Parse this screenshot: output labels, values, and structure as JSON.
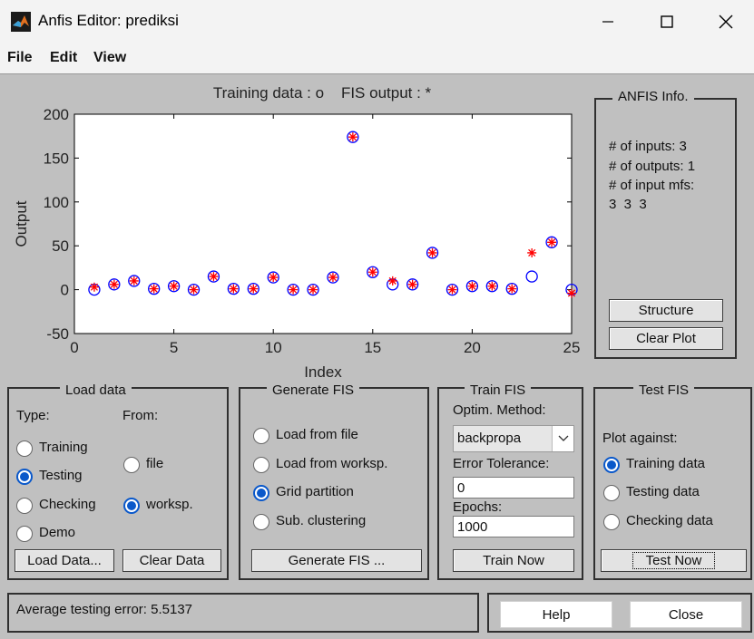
{
  "window": {
    "title": "Anfis Editor: prediksi",
    "app_icon": "matlab-icon",
    "controls": [
      "minimize-icon",
      "maximize-icon",
      "close-icon"
    ]
  },
  "menu": [
    "File",
    "Edit",
    "View"
  ],
  "plot": {
    "title": "Training data : o    FIS output : *"
  },
  "chart_data": {
    "type": "scatter",
    "xlabel": "Index",
    "ylabel": "Output",
    "xlim": [
      0,
      25
    ],
    "ylim": [
      -50,
      200
    ],
    "xticks": [
      0,
      5,
      10,
      15,
      20,
      25
    ],
    "yticks": [
      -50,
      0,
      50,
      100,
      150,
      200
    ],
    "grid": false,
    "series": [
      {
        "marker": "o",
        "color": "#0000ff",
        "x": [
          1,
          2,
          3,
          4,
          5,
          6,
          7,
          8,
          9,
          10,
          11,
          12,
          13,
          14,
          15,
          16,
          17,
          18,
          19,
          20,
          21,
          22,
          23,
          24,
          25
        ],
        "y": [
          0,
          6,
          10,
          1,
          4,
          0,
          15,
          1,
          1,
          14,
          0,
          0,
          14,
          174,
          20,
          6,
          6,
          42,
          0,
          4,
          4,
          1,
          15,
          54,
          0
        ]
      },
      {
        "marker": "*",
        "color": "#ff0000",
        "x": [
          1,
          2,
          3,
          4,
          5,
          6,
          7,
          8,
          9,
          10,
          11,
          12,
          13,
          14,
          15,
          16,
          17,
          18,
          19,
          20,
          21,
          22,
          23,
          24,
          25
        ],
        "y": [
          3,
          6,
          10,
          1,
          4,
          0,
          15,
          1,
          1,
          14,
          0,
          0,
          14,
          174,
          20,
          10,
          6,
          42,
          0,
          4,
          4,
          1,
          42,
          54,
          -4
        ]
      }
    ]
  },
  "anfis_info": {
    "legend": "ANFIS Info.",
    "lines": [
      "# of inputs: 3",
      "# of outputs: 1",
      "# of input mfs:",
      "3  3  3"
    ],
    "structure_button": "Structure",
    "clear_plot_button": "Clear Plot"
  },
  "load_data": {
    "legend": "Load data",
    "type_label": "Type:",
    "from_label": "From:",
    "types": [
      {
        "label": "Training",
        "selected": false
      },
      {
        "label": "Testing",
        "selected": true
      },
      {
        "label": "Checking",
        "selected": false
      },
      {
        "label": "Demo",
        "selected": false
      }
    ],
    "sources": [
      {
        "label": "file",
        "selected": false
      },
      {
        "label": "worksp.",
        "selected": true
      }
    ],
    "load_button": "Load Data...",
    "clear_button": "Clear Data"
  },
  "generate_fis": {
    "legend": "Generate FIS",
    "options": [
      {
        "label": "Load from file",
        "selected": false
      },
      {
        "label": "Load from worksp.",
        "selected": false
      },
      {
        "label": "Grid partition",
        "selected": true
      },
      {
        "label": "Sub. clustering",
        "selected": false
      }
    ],
    "button": "Generate FIS ..."
  },
  "train_fis": {
    "legend": "Train FIS",
    "method_label": "Optim. Method:",
    "method_value": "backpropa",
    "tolerance_label": "Error Tolerance:",
    "tolerance_value": "0",
    "epochs_label": "Epochs:",
    "epochs_value": "1000",
    "button": "Train Now"
  },
  "test_fis": {
    "legend": "Test FIS",
    "plot_against_label": "Plot against:",
    "options": [
      {
        "label": "Training data",
        "selected": true
      },
      {
        "label": "Testing data",
        "selected": false
      },
      {
        "label": "Checking data",
        "selected": false
      }
    ],
    "button": "Test Now"
  },
  "status": {
    "text": "Average testing error: 5.5137"
  },
  "footer": {
    "help_button": "Help",
    "close_button": "Close"
  }
}
